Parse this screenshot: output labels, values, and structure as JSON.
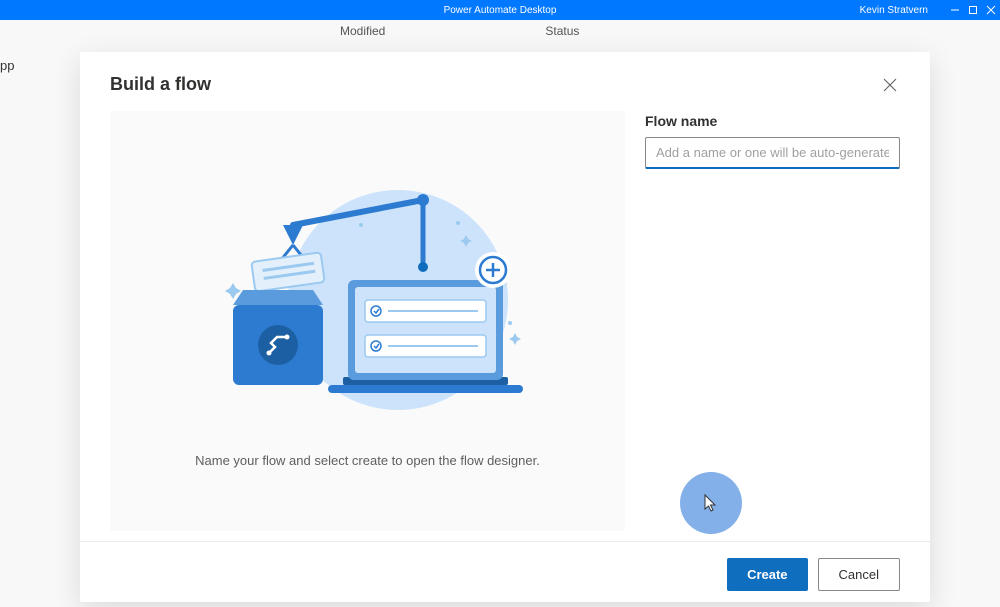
{
  "titlebar": {
    "app_title": "Power Automate Desktop",
    "user_name": "Kevin Stratvern"
  },
  "background": {
    "col_modified": "Modified",
    "col_status": "Status",
    "sidebar_item": "pp"
  },
  "dialog": {
    "title": "Build a flow",
    "caption": "Name your flow and select create to open the flow designer.",
    "flow_name_label": "Flow name",
    "flow_name_placeholder": "Add a name or one will be auto-generated",
    "flow_name_value": "",
    "create_button": "Create",
    "cancel_button": "Cancel"
  }
}
